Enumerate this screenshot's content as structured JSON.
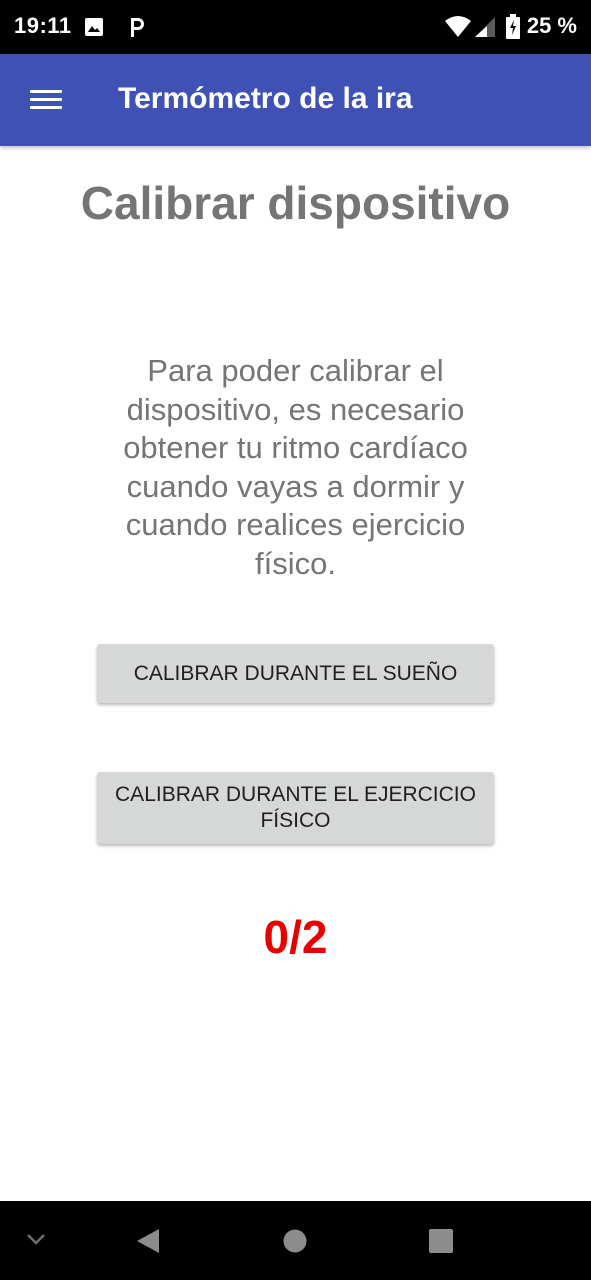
{
  "status_bar": {
    "time": "19:11",
    "battery": "25 %",
    "icons": [
      "image-icon",
      "parking-icon",
      "wifi-icon",
      "signal-icon",
      "battery-icon"
    ]
  },
  "app_bar": {
    "title": "Termómetro de la ira",
    "background_color": "#3f51b5"
  },
  "main": {
    "title": "Calibrar dispositivo",
    "description": "Para poder calibrar el dispositivo, es necesario obtener tu ritmo cardíaco cuando vayas a dormir y cuando realices ejercicio físico.",
    "buttons": {
      "sleep_label": "CALIBRAR DURANTE EL SUEÑO",
      "exercise_label": "CALIBRAR DURANTE EL EJERCICIO FÍSICO"
    },
    "progress": "0/2",
    "progress_color": "#e60000"
  },
  "nav_bar": {
    "icons": [
      "chevron-down-icon",
      "back-icon",
      "home-icon",
      "recents-icon"
    ]
  }
}
